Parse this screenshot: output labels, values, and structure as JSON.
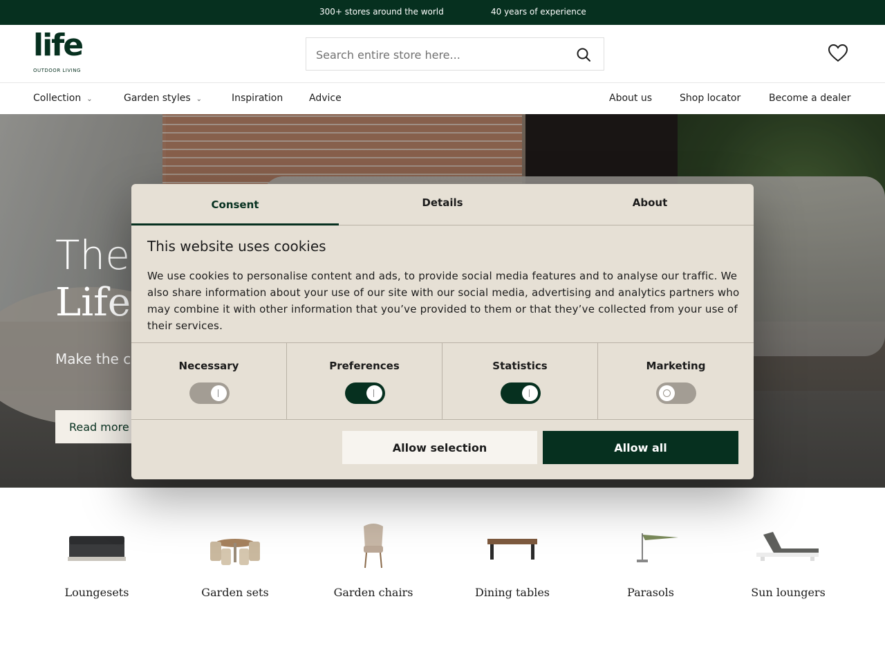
{
  "topbar": {
    "stores": "300+ stores around the world",
    "experience": "40 years of experience"
  },
  "header": {
    "logo_word": "life",
    "logo_tagline": "OUTDOOR LIVING",
    "search_placeholder": "Search entire store here...",
    "search_icon": "search-icon",
    "wishlist_icon": "heart-icon"
  },
  "nav": {
    "left": [
      {
        "label": "Collection",
        "dropdown": true
      },
      {
        "label": "Garden styles",
        "dropdown": true
      },
      {
        "label": "Inspiration",
        "dropdown": false
      },
      {
        "label": "Advice",
        "dropdown": false
      }
    ],
    "right": [
      {
        "label": "About us"
      },
      {
        "label": "Shop locator"
      },
      {
        "label": "Become a dealer"
      }
    ],
    "chevron": "⌄"
  },
  "hero": {
    "title_line1": "The",
    "title_line2": "Life C",
    "subtitle": "Make the c",
    "button": "Read more"
  },
  "categories": [
    {
      "label": "Loungesets"
    },
    {
      "label": "Garden sets"
    },
    {
      "label": "Garden chairs"
    },
    {
      "label": "Dining tables"
    },
    {
      "label": "Parasols"
    },
    {
      "label": "Sun loungers"
    }
  ],
  "cookie_dialog": {
    "tabs": [
      {
        "label": "Consent",
        "active": true
      },
      {
        "label": "Details",
        "active": false
      },
      {
        "label": "About",
        "active": false
      }
    ],
    "title": "This website uses cookies",
    "body": "We use cookies to personalise content and ads, to provide social media features and to analyse our traffic. We also share information about your use of our site with our social media, advertising and analytics partners who may combine it with other information that you’ve provided to them or that they’ve collected from your use of their services.",
    "preferences": [
      {
        "label": "Necessary",
        "state": "on",
        "disabled": true
      },
      {
        "label": "Preferences",
        "state": "on",
        "disabled": false
      },
      {
        "label": "Statistics",
        "state": "on",
        "disabled": false
      },
      {
        "label": "Marketing",
        "state": "off",
        "disabled": false
      }
    ],
    "allow_selection": "Allow selection",
    "allow_all": "Allow all"
  },
  "colors": {
    "brand_green": "#06301f",
    "dialog_bg": "#e6e0d5",
    "toggle_off": "#a39d94"
  }
}
